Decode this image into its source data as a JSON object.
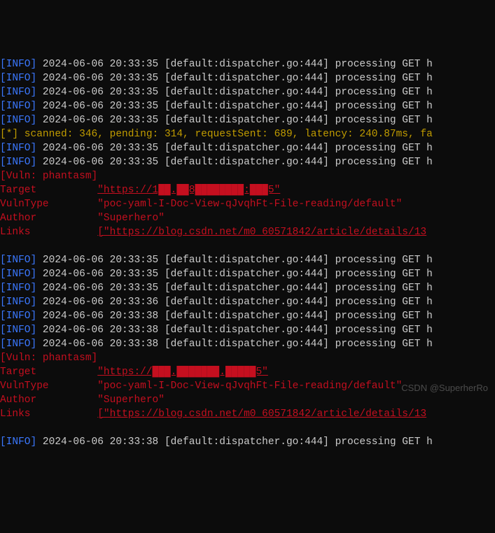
{
  "info_lines_1": [
    {
      "tag": "[INFO]",
      "ts": "2024-06-06 20:33:35",
      "src": "[default:dispatcher.go:444]",
      "msg": "processing GET h"
    },
    {
      "tag": "[INFO]",
      "ts": "2024-06-06 20:33:35",
      "src": "[default:dispatcher.go:444]",
      "msg": "processing GET h"
    },
    {
      "tag": "[INFO]",
      "ts": "2024-06-06 20:33:35",
      "src": "[default:dispatcher.go:444]",
      "msg": "processing GET h"
    },
    {
      "tag": "[INFO]",
      "ts": "2024-06-06 20:33:35",
      "src": "[default:dispatcher.go:444]",
      "msg": "processing GET h"
    },
    {
      "tag": "[INFO]",
      "ts": "2024-06-06 20:33:35",
      "src": "[default:dispatcher.go:444]",
      "msg": "processing GET h"
    }
  ],
  "stats": "[*] scanned: 346, pending: 314, requestSent: 689, latency: 240.87ms, fa",
  "info_lines_2": [
    {
      "tag": "[INFO]",
      "ts": "2024-06-06 20:33:35",
      "src": "[default:dispatcher.go:444]",
      "msg": "processing GET h"
    },
    {
      "tag": "[INFO]",
      "ts": "2024-06-06 20:33:35",
      "src": "[default:dispatcher.go:444]",
      "msg": "processing GET h"
    }
  ],
  "vuln_1": {
    "header": "[Vuln: phantasm]",
    "target_label": "Target          ",
    "target_value": "\"https://1██.██8████████:███5\"",
    "vulntype_label": "VulnType        ",
    "vulntype_value": "\"poc-yaml-I-Doc-View-qJvqhFt-File-reading/default\"",
    "author_label": "Author          ",
    "author_value": "\"Superhero\"",
    "links_label": "Links           ",
    "links_value": "[\"https://blog.csdn.net/m0_60571842/article/details/13"
  },
  "info_lines_3": [
    {
      "tag": "[INFO]",
      "ts": "2024-06-06 20:33:35",
      "src": "[default:dispatcher.go:444]",
      "msg": "processing GET h"
    },
    {
      "tag": "[INFO]",
      "ts": "2024-06-06 20:33:35",
      "src": "[default:dispatcher.go:444]",
      "msg": "processing GET h"
    },
    {
      "tag": "[INFO]",
      "ts": "2024-06-06 20:33:35",
      "src": "[default:dispatcher.go:444]",
      "msg": "processing GET h"
    },
    {
      "tag": "[INFO]",
      "ts": "2024-06-06 20:33:36",
      "src": "[default:dispatcher.go:444]",
      "msg": "processing GET h"
    },
    {
      "tag": "[INFO]",
      "ts": "2024-06-06 20:33:38",
      "src": "[default:dispatcher.go:444]",
      "msg": "processing GET h"
    },
    {
      "tag": "[INFO]",
      "ts": "2024-06-06 20:33:38",
      "src": "[default:dispatcher.go:444]",
      "msg": "processing GET h"
    },
    {
      "tag": "[INFO]",
      "ts": "2024-06-06 20:33:38",
      "src": "[default:dispatcher.go:444]",
      "msg": "processing GET h"
    }
  ],
  "vuln_2": {
    "header": "[Vuln: phantasm]",
    "target_label": "Target          ",
    "target_value": "\"https://███.███████.█████5\"",
    "vulntype_label": "VulnType        ",
    "vulntype_value": "\"poc-yaml-I-Doc-View-qJvqhFt-File-reading/default\"",
    "author_label": "Author          ",
    "author_value": "\"Superhero\"",
    "links_label": "Links           ",
    "links_value": "[\"https://blog.csdn.net/m0_60571842/article/details/13"
  },
  "info_lines_4": [
    {
      "tag": "[INFO]",
      "ts": "2024-06-06 20:33:38",
      "src": "[default:dispatcher.go:444]",
      "msg": "processing GET h"
    }
  ],
  "watermark": "CSDN @SuperherRo"
}
